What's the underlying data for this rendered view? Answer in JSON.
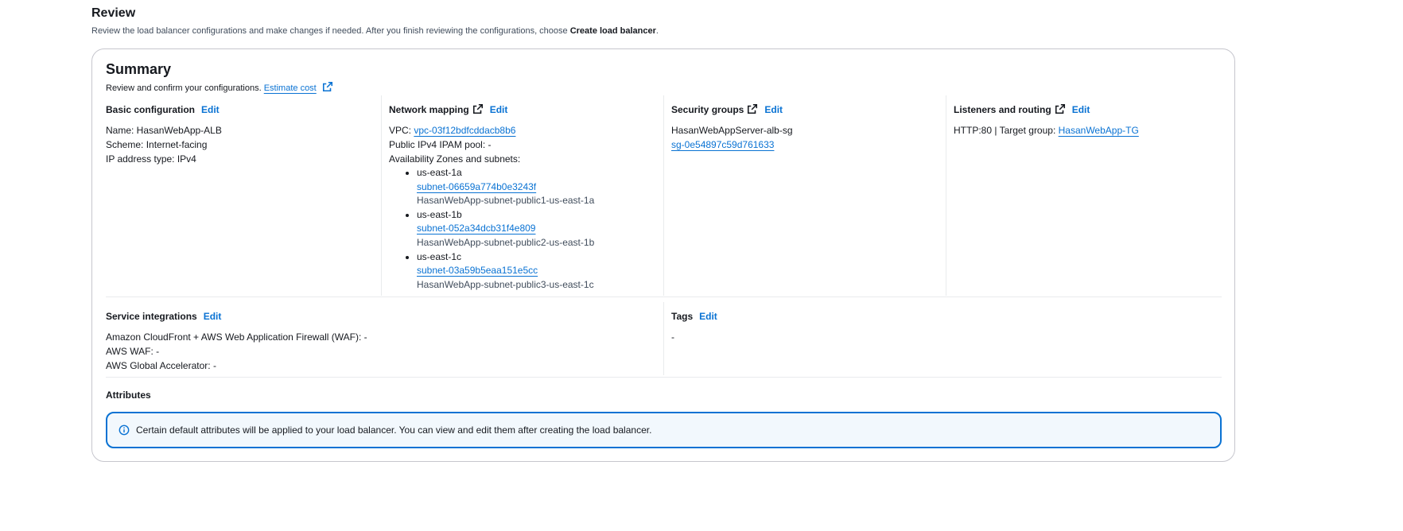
{
  "review": {
    "title": "Review",
    "description_prefix": "Review the load balancer configurations and make changes if needed. After you finish reviewing the configurations, choose ",
    "description_bold": "Create load balancer",
    "description_suffix": "."
  },
  "summary": {
    "title": "Summary",
    "description": "Review and confirm your configurations.",
    "estimate_cost": "Estimate cost"
  },
  "edit_label": "Edit",
  "basic": {
    "title": "Basic configuration",
    "name": "Name: HasanWebApp-ALB",
    "scheme": "Scheme: Internet-facing",
    "ip_type": "IP address type: IPv4"
  },
  "network": {
    "title": "Network mapping",
    "vpc_label": "VPC: ",
    "vpc_id": "vpc-03f12bdfcddacb8b6",
    "ipam": "Public IPv4 IPAM pool: -",
    "az_title": "Availability Zones and subnets:",
    "zones": [
      {
        "zone": "us-east-1a",
        "subnet_id": "subnet-06659a774b0e3243f",
        "subnet_name": "HasanWebApp-subnet-public1-us-east-1a"
      },
      {
        "zone": "us-east-1b",
        "subnet_id": "subnet-052a34dcb31f4e809",
        "subnet_name": "HasanWebApp-subnet-public2-us-east-1b"
      },
      {
        "zone": "us-east-1c",
        "subnet_id": "subnet-03a59b5eaa151e5cc",
        "subnet_name": "HasanWebApp-subnet-public3-us-east-1c"
      }
    ]
  },
  "security": {
    "title": "Security groups",
    "group_name": "HasanWebAppServer-alb-sg",
    "group_id": "sg-0e54897c59d761633"
  },
  "listeners": {
    "title": "Listeners and routing",
    "text": "HTTP:80 | Target group: ",
    "target_group": "HasanWebApp-TG"
  },
  "integrations": {
    "title": "Service integrations",
    "cloudfront": "Amazon CloudFront + AWS Web Application Firewall (WAF): -",
    "waf": "AWS WAF: -",
    "accelerator": "AWS Global Accelerator: -"
  },
  "tags": {
    "title": "Tags",
    "value": "-"
  },
  "attributes": {
    "title": "Attributes",
    "alert": "Certain default attributes will be applied to your load balancer. You can view and edit them after creating the load balancer."
  },
  "colors": {
    "link": "#0972d3",
    "border": "#c6c6cd",
    "alert_bg": "#f2f8fd"
  }
}
